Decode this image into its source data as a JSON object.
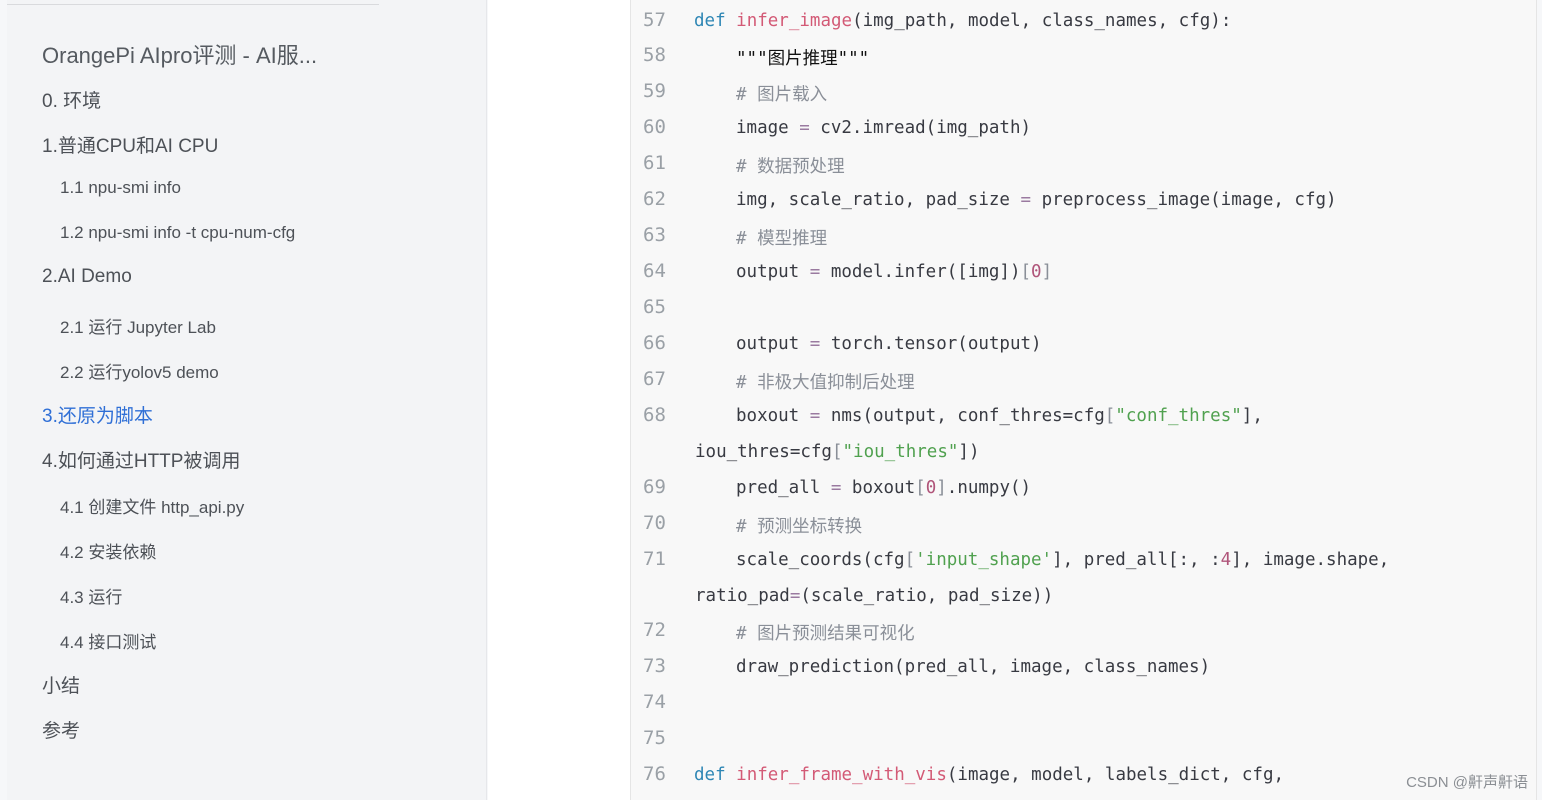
{
  "toc": {
    "title": "OrangePi AIpro评测 - AI服...",
    "items": [
      {
        "label": "0. 环境"
      },
      {
        "label": "1.普通CPU和AI CPU"
      },
      {
        "label": "1.1 npu-smi info"
      },
      {
        "label": "1.2 npu-smi info -t cpu-num-cfg"
      },
      {
        "label": "2.AI Demo"
      },
      {
        "label": "2.1 运行 Jupyter Lab"
      },
      {
        "label": "2.2 运行yolov5 demo"
      },
      {
        "label": "3.还原为脚本"
      },
      {
        "label": "4.如何通过HTTP被调用"
      },
      {
        "label": "4.1 创建文件 http_api.py"
      },
      {
        "label": "4.2 安装依赖"
      },
      {
        "label": "4.3 运行"
      },
      {
        "label": "4.4 接口测试"
      },
      {
        "label": "小结"
      },
      {
        "label": "参考"
      }
    ]
  },
  "code": {
    "line_numbers": [
      "57",
      "58",
      "59",
      "60",
      "61",
      "62",
      "63",
      "64",
      "65",
      "66",
      "67",
      "68",
      "69",
      "70",
      "71",
      "72",
      "73",
      "74",
      "75",
      "76"
    ],
    "tokens": {
      "def": "def",
      "infer_image": "infer_image",
      "l57_params": "(img_path, model, class_names, cfg):",
      "docstring": "\"\"\"图片推理\"\"\"",
      "c59": "# 图片载入",
      "l60a": "image ",
      "eq": "=",
      "l60b": " cv2.imread(img_path)",
      "c61": "# 数据预处理",
      "l62a": "img, scale_ratio, pad_size ",
      "l62b": " preprocess_image(image, cfg)",
      "c63": "# 模型推理",
      "l64a": "output ",
      "l64b": " model.infer([img])",
      "lb": "[",
      "rb": "]",
      "zero": "0",
      "l66a": "output ",
      "l66b": " torch.tensor(output)",
      "c67": "# 非极大值抑制后处理",
      "l68a": "boxout ",
      "l68b": " nms(output, conf_thres=cfg",
      "s_conf": "\"conf_thres\"",
      "l68c": "],",
      "l68d": "iou_thres=cfg",
      "s_iou": "\"iou_thres\"",
      "l68e": "])",
      "l69a": "pred_all ",
      "l69b": " boxout",
      "l69c": ".numpy()",
      "c70": "# 预测坐标转换",
      "l71a": "scale_coords(cfg",
      "s_input": "'input_shape'",
      "l71b": "], pred_all[:, :",
      "four": "4",
      "l71c": "], image.shape,",
      "l71d": "ratio_pad",
      "l71e": "(scale_ratio, pad_size))",
      "c72": "# 图片预测结果可视化",
      "l73": "draw_prediction(pred_all, image, class_names)",
      "infer_frame": "infer_frame_with_vis",
      "l76_params": "(image, model, labels_dict, cfg,"
    }
  },
  "watermark": "CSDN @鼾声鼾语"
}
